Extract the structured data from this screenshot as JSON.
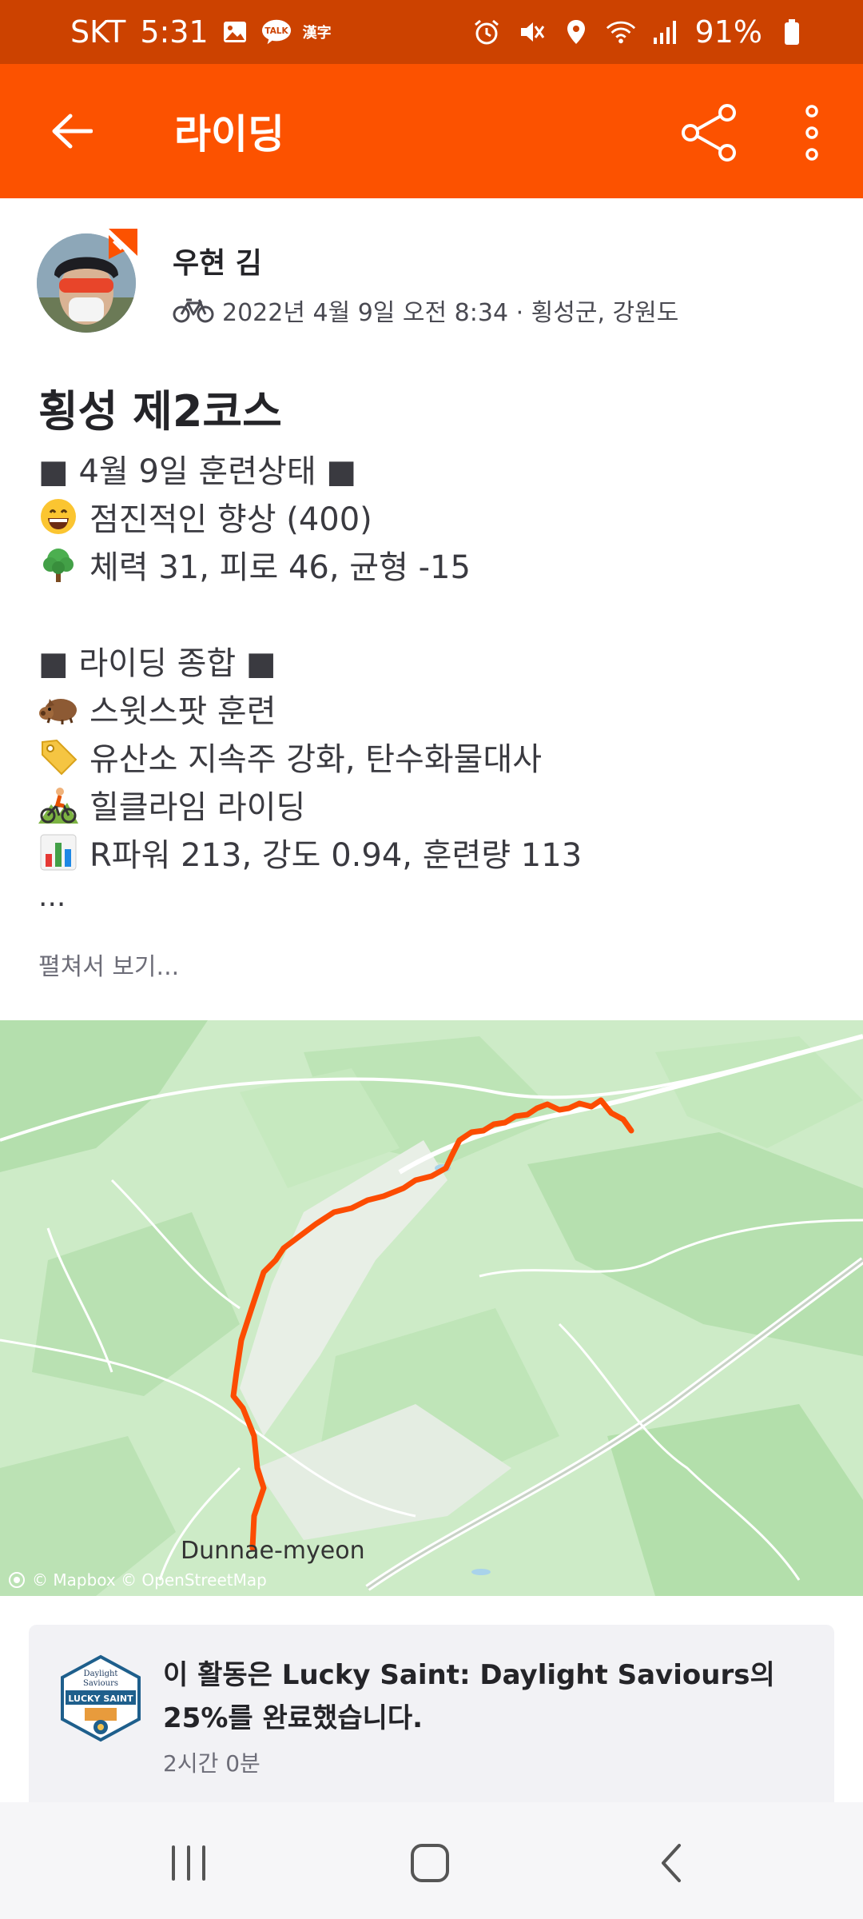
{
  "status_bar": {
    "carrier": "SKT",
    "time": "5:31",
    "battery": "91%",
    "icons_left": [
      "gallery-icon",
      "talk-icon",
      "hanja-icon"
    ],
    "talk_label": "TALK",
    "hanja_label": "漢字",
    "icons_right": [
      "alarm-icon",
      "mute-icon",
      "location-icon",
      "wifi-icon",
      "signal-icon",
      "battery-icon"
    ]
  },
  "app_bar": {
    "title": "라이딩",
    "icons": [
      "back-arrow-icon",
      "share-icon",
      "more-vert-icon"
    ]
  },
  "colors": {
    "brand": "#fc5200",
    "status_bar": "#cc4200",
    "route": "#fc4c02"
  },
  "activity": {
    "athlete_name": "우현 김",
    "sport_icon": "bicycle-icon",
    "meta": "2022년 4월 9일 오전 8:34 · 횡성군, 강원도",
    "title": "횡성 제2코스",
    "description": [
      {
        "emoji": "",
        "text": "■ 4월 9일 훈련상태 ■"
      },
      {
        "emoji": "grinning-face-icon",
        "text": "점진적인 향상 (400)"
      },
      {
        "emoji": "tree-icon",
        "text": "체력 31, 피로 46, 균형 -15"
      },
      {
        "emoji": "",
        "text": ""
      },
      {
        "emoji": "",
        "text": "■ 라이딩 종합 ■"
      },
      {
        "emoji": "boar-icon",
        "text": "스윗스팟 훈련"
      },
      {
        "emoji": "tag-icon",
        "text": "유산소 지속주 강화, 탄수화물대사"
      },
      {
        "emoji": "mountain-biker-icon",
        "text": "힐클라임 라이딩"
      },
      {
        "emoji": "bar-chart-icon",
        "text": "R파워 213, 강도 0.94, 훈련량 113"
      }
    ],
    "ellipsis": "...",
    "expand_label": "펼쳐서 보기..."
  },
  "map": {
    "place_label": "Dunnae-myeon",
    "attribution": "© Mapbox © OpenStreetMap"
  },
  "challenge": {
    "text": "이 활동은 Lucky Saint: Daylight Saviours의 25%를 완료했습니다.",
    "time": "2시간 0분",
    "badge_top": "Daylight",
    "badge_mid": "Saviours",
    "badge_name": "LUCKY SAINT"
  },
  "nav": {
    "icons": [
      "recent-apps-icon",
      "home-icon",
      "back-icon"
    ]
  }
}
